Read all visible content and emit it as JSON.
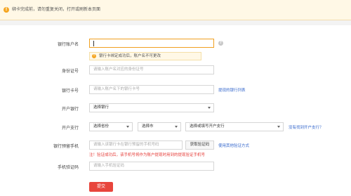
{
  "notice_bar": {
    "text": "绑卡完成前，请勿重复关闭，打开或刷新本页面",
    "icon": "warning-icon"
  },
  "form": {
    "account_name": {
      "label": "银行账户名",
      "value": "",
      "help_icon": "help-icon"
    },
    "account_tip": {
      "text": "银行卡绑定成功后，账户名不可更改",
      "icon": "info-icon"
    },
    "id_number": {
      "label": "身份证号",
      "placeholder": "请输入账户名对应的身份证号"
    },
    "card_number": {
      "label": "银行卡号",
      "placeholder": "请输入账户名下的银行卡号",
      "link": "提现的银行列表"
    },
    "bank": {
      "label": "开户银行",
      "selected": "选择银行"
    },
    "branch": {
      "label": "开户支行",
      "province": "选择省份",
      "city": "选择市",
      "branch_select": "选择或填写开户支行",
      "link": "没有找到开户支行？"
    },
    "phone": {
      "label": "银行预留手机",
      "placeholder": "请输入该银行卡在银行预留的手机号码",
      "code_button": "获取验证码",
      "link": "使用其他验证方式",
      "notice": "注！验证成功后，该手机号将作为账户提现时用到的提现验证手机号"
    },
    "sms_code": {
      "label": "手机验证码",
      "placeholder": "请输入手机验证码"
    },
    "submit_label": "提交"
  }
}
